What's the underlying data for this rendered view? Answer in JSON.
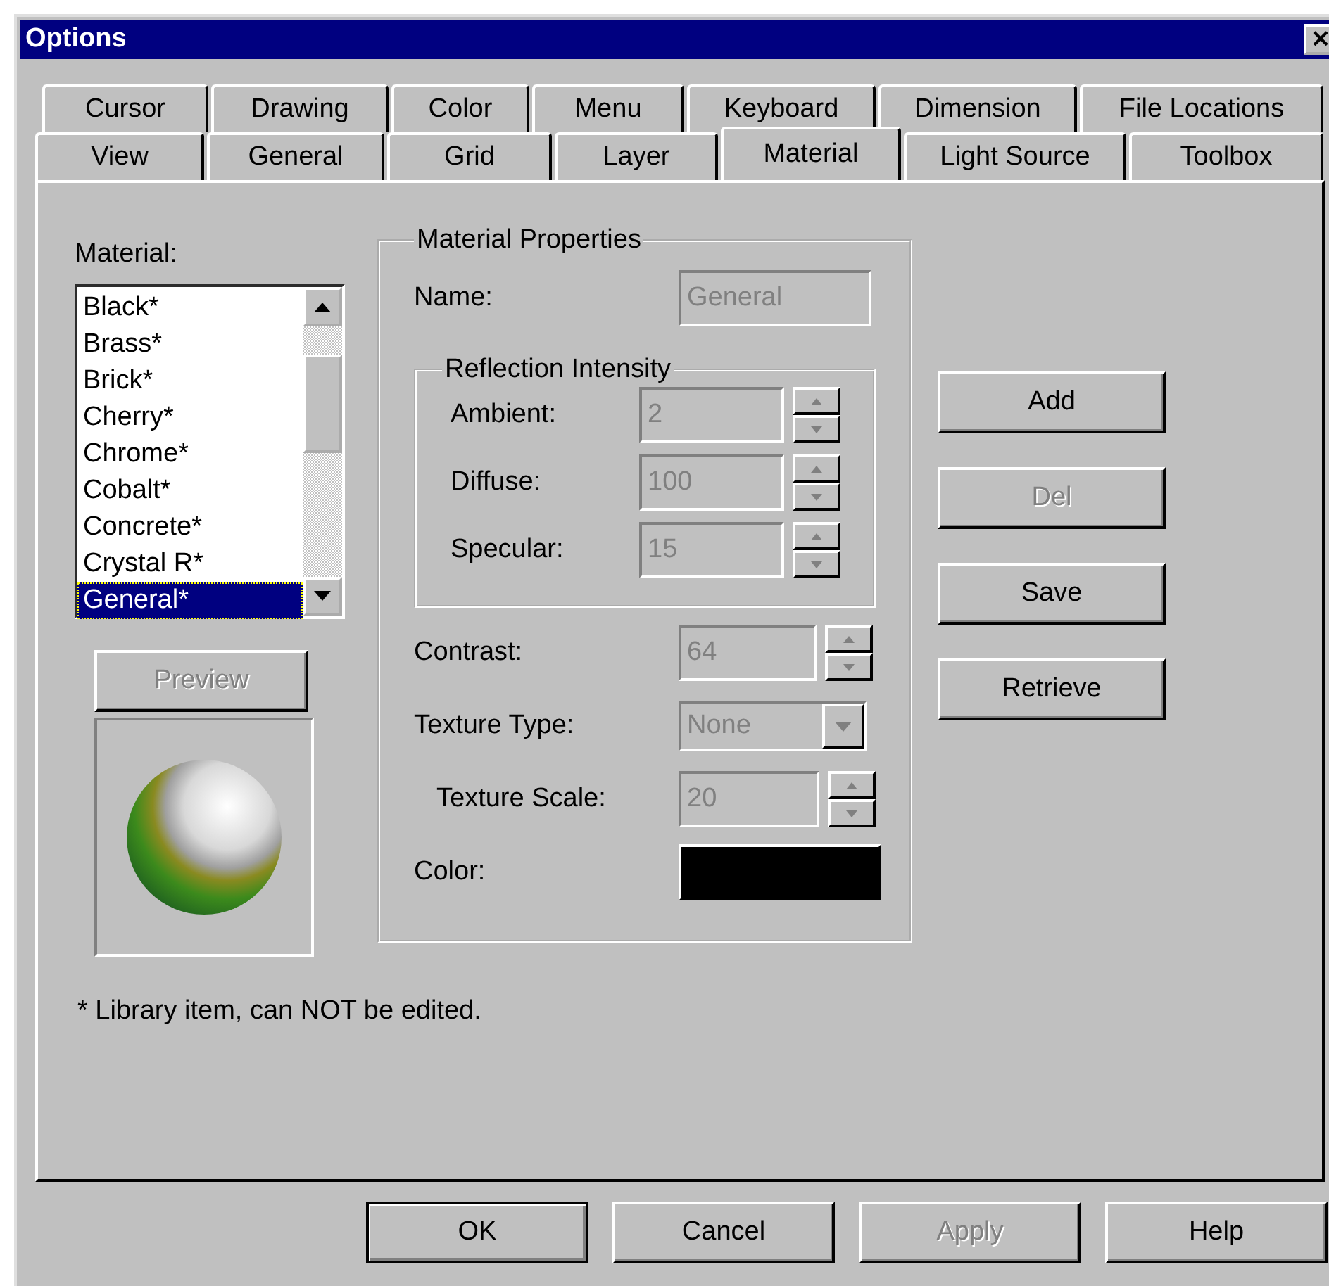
{
  "window": {
    "title": "Options",
    "close": "×"
  },
  "tab_rows": [
    [
      {
        "label": "Cursor",
        "selected": false
      },
      {
        "label": "Drawing",
        "selected": false
      },
      {
        "label": "Color",
        "selected": false
      },
      {
        "label": "Menu",
        "selected": false
      },
      {
        "label": "Keyboard",
        "selected": false
      },
      {
        "label": "Dimension",
        "selected": false
      },
      {
        "label": "File Locations",
        "selected": false
      }
    ],
    [
      {
        "label": "View",
        "selected": false
      },
      {
        "label": "General",
        "selected": false
      },
      {
        "label": "Grid",
        "selected": false
      },
      {
        "label": "Layer",
        "selected": false
      },
      {
        "label": "Material",
        "selected": true
      },
      {
        "label": "Light Source",
        "selected": false
      },
      {
        "label": "Toolbox",
        "selected": false
      }
    ]
  ],
  "material_list": {
    "label": "Material:",
    "items": [
      {
        "label": "Black*",
        "selected": false
      },
      {
        "label": "Brass*",
        "selected": false
      },
      {
        "label": "Brick*",
        "selected": false
      },
      {
        "label": "Cherry*",
        "selected": false
      },
      {
        "label": "Chrome*",
        "selected": false
      },
      {
        "label": "Cobalt*",
        "selected": false
      },
      {
        "label": "Concrete*",
        "selected": false
      },
      {
        "label": "Crystal R*",
        "selected": false
      },
      {
        "label": "General*",
        "selected": true
      }
    ]
  },
  "preview_button": {
    "label": "Preview",
    "disabled": true
  },
  "properties": {
    "title": "Material Properties",
    "name": {
      "label": "Name:",
      "value": "General",
      "disabled": true
    },
    "reflection": {
      "title": "Reflection Intensity",
      "fields": [
        {
          "label": "Ambient:",
          "value": "2",
          "disabled": true
        },
        {
          "label": "Diffuse:",
          "value": "100",
          "disabled": true
        },
        {
          "label": "Specular:",
          "value": "15",
          "disabled": true
        }
      ]
    },
    "contrast": {
      "label": "Contrast:",
      "value": "64",
      "disabled": true
    },
    "texture_type": {
      "label": "Texture Type:",
      "value": "None",
      "disabled": true
    },
    "texture_scale": {
      "label": "Texture Scale:",
      "value": "20",
      "disabled": true
    },
    "color": {
      "label": "Color:",
      "color": "#000000"
    }
  },
  "side_buttons": [
    {
      "label": "Add",
      "disabled": false
    },
    {
      "label": "Del",
      "disabled": true
    },
    {
      "label": "Save",
      "disabled": false
    },
    {
      "label": "Retrieve",
      "disabled": false
    }
  ],
  "note": "* Library item, can NOT be edited.",
  "buttons": [
    {
      "label": "OK",
      "disabled": false,
      "default": true
    },
    {
      "label": "Cancel",
      "disabled": false,
      "default": false
    },
    {
      "label": "Apply",
      "disabled": true,
      "default": false
    },
    {
      "label": "Help",
      "disabled": false,
      "default": false
    }
  ]
}
